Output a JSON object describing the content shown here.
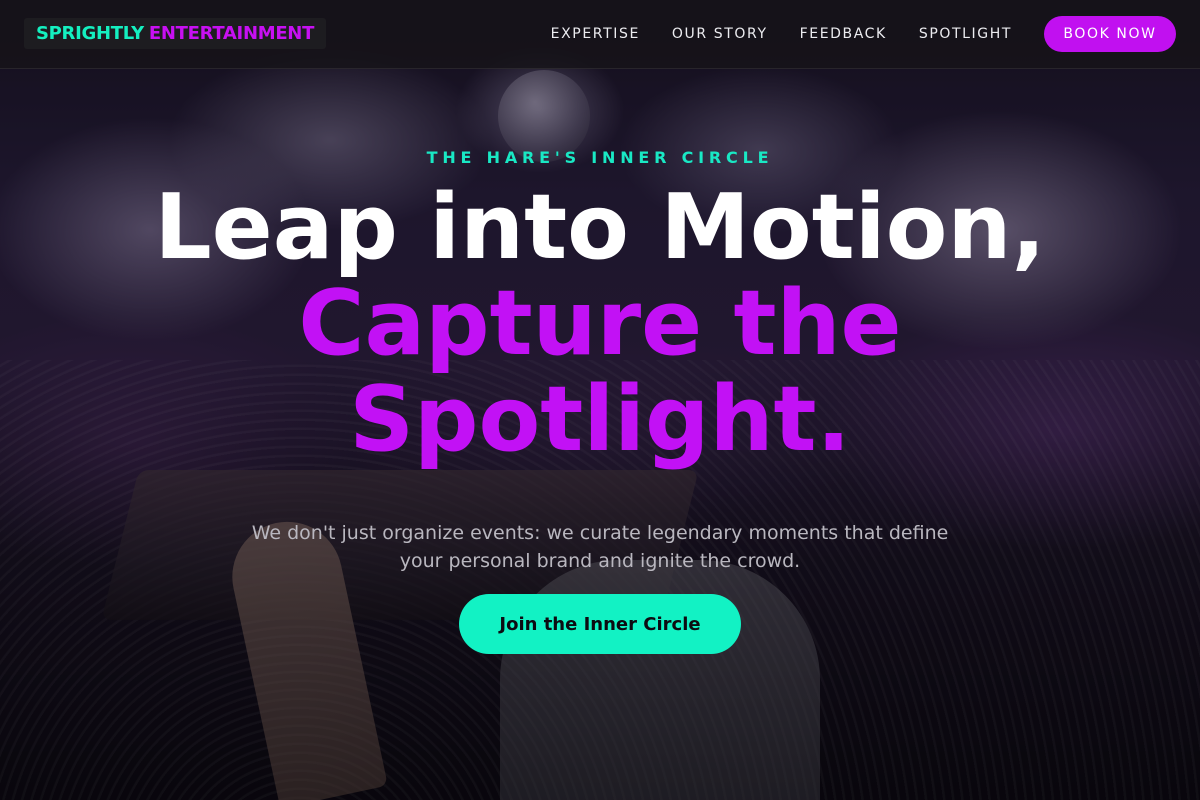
{
  "header": {
    "logo": {
      "part_a": "SPRIGHTLY",
      "part_b": "ENTERTAINMENT"
    },
    "nav": [
      {
        "label": "EXPERTISE"
      },
      {
        "label": "OUR STORY"
      },
      {
        "label": "FEEDBACK"
      },
      {
        "label": "SPOTLIGHT"
      }
    ],
    "cta_label": "BOOK NOW"
  },
  "hero": {
    "eyebrow": "THE HARE'S INNER CIRCLE",
    "headline": {
      "line1": "Leap into Motion,",
      "line2": "Capture the",
      "line3": "Spotlight."
    },
    "subtext": "We don't just organize events: we curate legendary moments that define your personal brand and ignite the crowd.",
    "cta_label": "Join the Inner Circle",
    "background": "DJ booth in crowded nightclub with fog cannons and stage lights"
  },
  "colors": {
    "accent_teal": "#12f2c4",
    "accent_purple": "#c211f5",
    "header_bg": "#161418"
  }
}
